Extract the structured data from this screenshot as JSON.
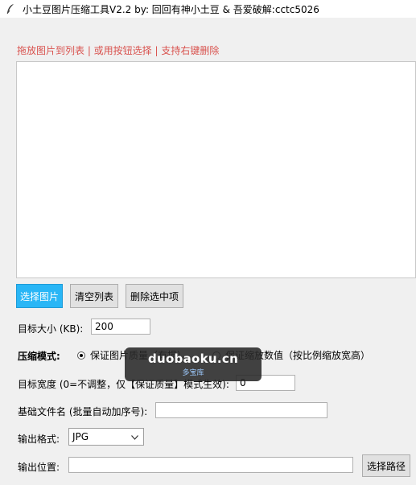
{
  "window": {
    "title": "小土豆图片压缩工具V2.2 by: 回回有神小土豆 & 吾爱破解:cctc5026",
    "icon": "feather-icon"
  },
  "hint": "拖放图片到列表 | 或用按钮选择 | 支持右键删除",
  "buttons": {
    "select_images": "选择图片",
    "clear_list": "清空列表",
    "delete_selected": "删除选中项",
    "choose_path": "选择路径"
  },
  "target_size": {
    "label": "目标大小 (KB):",
    "value": "200"
  },
  "compression_mode": {
    "label": "压缩模式:",
    "options": [
      {
        "label": "保证图片质量（有损）",
        "selected": true
      },
      {
        "label": "保证缩放数值（按比例缩放宽高）",
        "selected": false
      }
    ]
  },
  "target_width": {
    "label": "目标宽度 (0=不调整，仅【保证质量】模式生效):",
    "value": "0"
  },
  "base_filename": {
    "label": "基础文件名 (批量自动加序号):",
    "value": ""
  },
  "output_format": {
    "label": "输出格式:",
    "value": "JPG"
  },
  "output_location": {
    "label": "输出位置:",
    "value": ""
  },
  "watermark": {
    "main": "duobaoku.cn",
    "sub": "多宝库"
  }
}
